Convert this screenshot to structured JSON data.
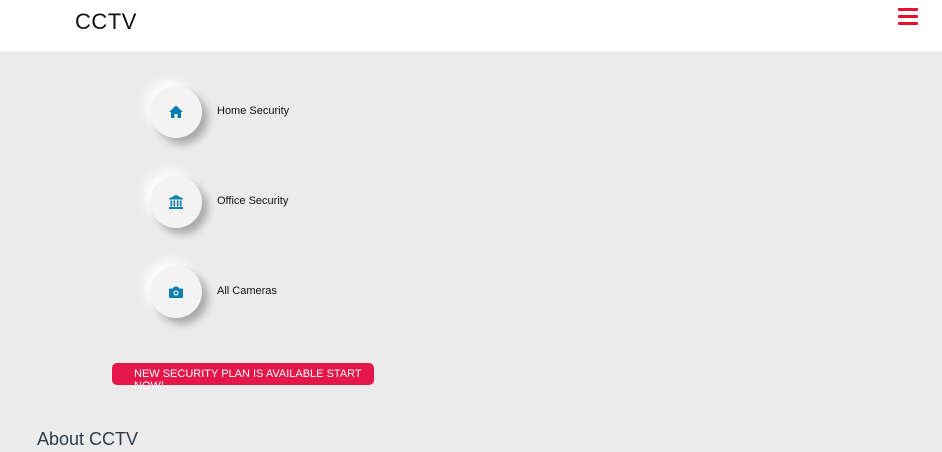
{
  "header": {
    "brand": "CCTV",
    "menu_icon": "hamburger-menu-icon"
  },
  "features": [
    {
      "label": "Home Security",
      "icon": "home-icon"
    },
    {
      "label": "Office Security",
      "icon": "bank-building-icon"
    },
    {
      "label": "All Cameras",
      "icon": "camera-icon"
    }
  ],
  "promo": {
    "text": "NEW SECURITY PLAN IS AVAILABLE START NOW!"
  },
  "about": {
    "title": "About CCTV"
  },
  "colors": {
    "accent": "#e8102e",
    "icon": "#0c7fb0",
    "background": "#ebebeb",
    "header_bg": "#ffffff"
  }
}
